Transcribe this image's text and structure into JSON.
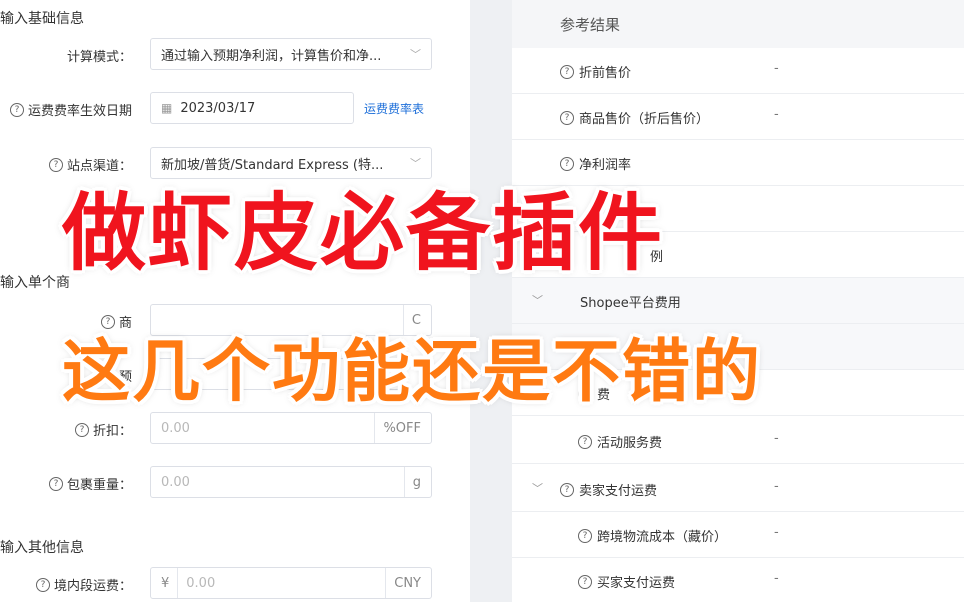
{
  "left": {
    "sections": {
      "basic": "输入基础信息",
      "single": "输入单个商",
      "other": "输入其他信息"
    },
    "mode": {
      "label": "计算模式：",
      "value": "通过输入预期净利润，计算售价和净..."
    },
    "date": {
      "label": "运费费率生效日期",
      "value": "2023/03/17",
      "link": "运费费率表"
    },
    "site": {
      "label": "站点渠道：",
      "value": "新加坡/普货/Standard Express (特..."
    },
    "cost": {
      "label": "商",
      "suffix": "C"
    },
    "profit": {
      "label": "预"
    },
    "discount": {
      "label": "折扣：",
      "placeholder": "0.00",
      "suffix": "%OFF"
    },
    "weight": {
      "label": "包裹重量：",
      "placeholder": "0.00",
      "suffix": "g"
    },
    "domestic": {
      "label": "境内段运费：",
      "prefix": "¥",
      "placeholder": "0.00",
      "suffix": "CNY"
    }
  },
  "right": {
    "title": "参考结果",
    "rows": [
      {
        "label": "折前售价",
        "value": "-"
      },
      {
        "label": "商品售价（折后售价）",
        "value": "-"
      },
      {
        "label": "净利润率",
        "value": ""
      },
      {
        "label": "例",
        "value": ""
      },
      {
        "label": "Shopee平台费用",
        "value": ""
      },
      {
        "label": "",
        "value": ""
      },
      {
        "label": "费",
        "value": ""
      },
      {
        "label": "活动服务费",
        "value": "-"
      },
      {
        "label": "卖家支付运费",
        "value": "-"
      },
      {
        "label": "跨境物流成本（藏价）",
        "value": "-"
      },
      {
        "label": "买家支付运费",
        "value": "-"
      }
    ]
  },
  "overlay": {
    "line1": "做虾皮必备插件",
    "line2": "这几个功能还是不错的"
  },
  "colors": {
    "red": "#f0141e",
    "orange": "#ff7a12",
    "link": "#1e6fd9"
  }
}
